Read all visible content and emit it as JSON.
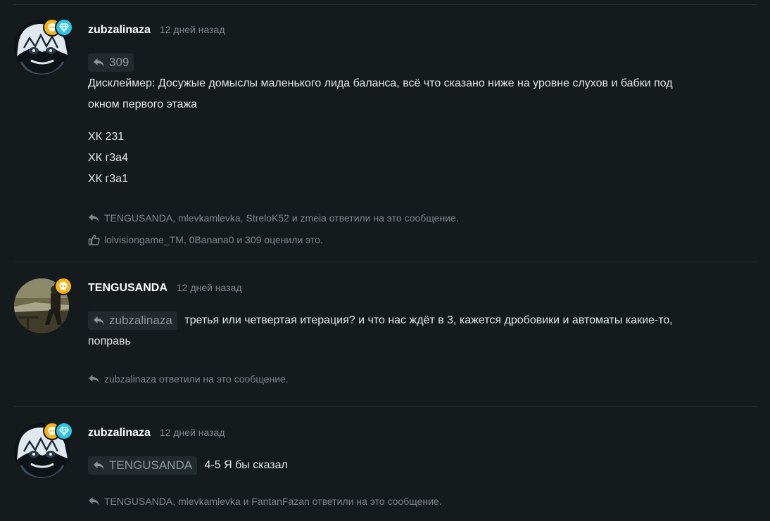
{
  "posts": [
    {
      "username": "zubzalinaza",
      "time": "12 дней назад",
      "quote_label": "309",
      "body_lines": [
        "Дисклеймер: Досужые домыслы маленького лида баланса, всё что сказано ниже на уровне слухов и бабки под",
        "окном первого этажа"
      ],
      "list_lines": [
        "ХК 231",
        "ХК г3а4",
        "ХК г3а1"
      ],
      "replies_text": "TENGUSANDA, mlevkamlevka, StreloK52 и zmeia ответили на это сообщение.",
      "likes_text": "lolvisiongame_TM, 0Banana0 и 309 оценили это.",
      "badges": [
        "skull-gold",
        "diamond-cyan"
      ]
    },
    {
      "username": "TENGUSANDA",
      "time": "12 дней назад",
      "quote_label": "zubzalinaza",
      "body_first": "третья или четвертая итерация? и что нас ждёт в 3, кажется дробовики и автоматы какие-то,",
      "body_second": "поправь",
      "replies_text": "zubzalinaza ответили на это сообщение.",
      "badges": [
        "skull-gold"
      ]
    },
    {
      "username": "zubzalinaza",
      "time": "12 дней назад",
      "quote_label": "TENGUSANDA",
      "body_first": "4-5 Я бы сказал",
      "replies_text": "TENGUSANDA, mlevkamlevka и FantanFazan ответили на это сообщение.",
      "badges": [
        "skull-gold",
        "diamond-cyan"
      ]
    }
  ],
  "icons": {
    "reply": "reply-arrow-icon",
    "like": "thumbs-up-icon",
    "skull": "skull-icon",
    "diamond": "diamond-icon"
  },
  "colors": {
    "background": "#151a1d",
    "username": "#ffffff",
    "muted": "#7d868c",
    "badge_gold": "#f4b41a",
    "badge_cyan": "#2bc6e6"
  }
}
